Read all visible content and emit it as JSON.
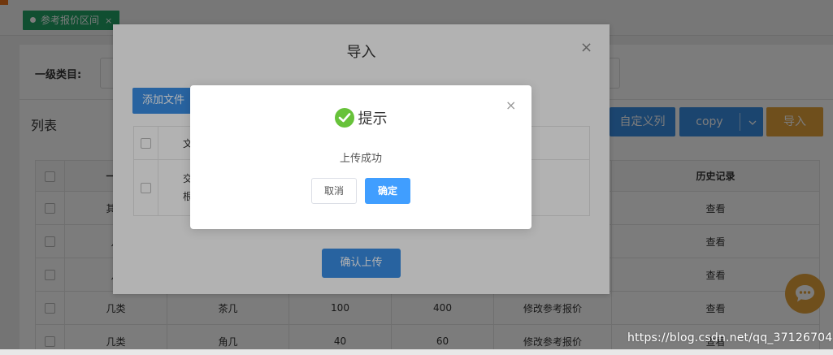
{
  "tab": {
    "label": "参考报价区间",
    "close": "×"
  },
  "filter": {
    "label": "一级类目:"
  },
  "list": {
    "title": "列表",
    "buttons": {
      "custom_columns": "自定义列",
      "copy": "copy",
      "import": "导入"
    },
    "headers": [
      "一级",
      "",
      "",
      "",
      "",
      "历史记录"
    ],
    "rows": [
      [
        "其他",
        "",
        "",
        "",
        "",
        "查看"
      ],
      [
        "几",
        "",
        "",
        "",
        "",
        "查看"
      ],
      [
        "几",
        "",
        "",
        "",
        "",
        "查看"
      ],
      [
        "几类",
        "茶几",
        "100",
        "400",
        "修改参考报价",
        "查看"
      ],
      [
        "几类",
        "角几",
        "40",
        "60",
        "修改参考报价",
        "查看"
      ]
    ]
  },
  "import_dialog": {
    "title": "导入",
    "close": "×",
    "add_file": "添加文件",
    "table_header_partial": "文",
    "row_partial_1": "交",
    "row_partial_2": "根",
    "confirm_upload": "确认上传"
  },
  "message_box": {
    "title": "提示",
    "body": "上传成功",
    "cancel": "取消",
    "ok": "确定",
    "close": "×",
    "icon": "success-check-icon"
  },
  "watermark": "https://blog.csdn.net/qq_37126704",
  "colors": {
    "primary": "#3a8ee6",
    "warning": "#e6a23c",
    "success": "#67c23a",
    "tag_green": "#22a266",
    "link": "#2d7cd6"
  }
}
